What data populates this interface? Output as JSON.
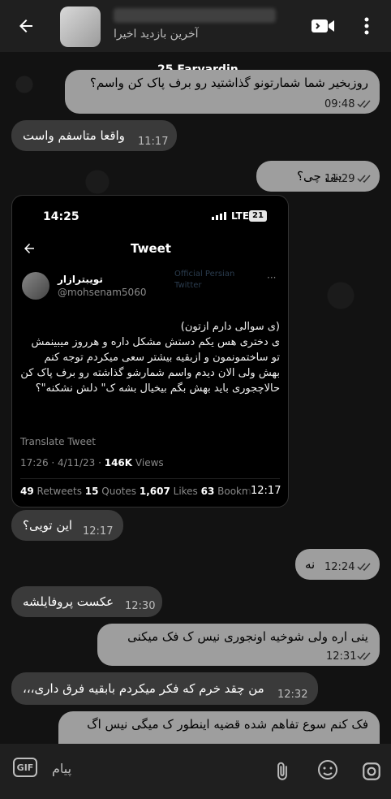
{
  "header": {
    "status": "آخرین بازدید اخیرا",
    "back_icon": "arrow-left-icon",
    "video_icon": "video-call-icon",
    "more_icon": "more-vertical-icon"
  },
  "date_separator": "25 Farvardin",
  "messages": [
    {
      "dir": "out",
      "text": "روزبخیر شما شمارتونو گذاشتید رو برف پاک کن واسم؟",
      "time": "09:48"
    },
    {
      "dir": "in",
      "text": "واقعا متاسفم واست",
      "time": "11:17"
    },
    {
      "dir": "out",
      "text": "ینی چی؟",
      "time": "11:29"
    },
    {
      "dir": "in",
      "text": "این تویی؟",
      "time": "12:17"
    },
    {
      "dir": "out",
      "text": "نه",
      "time": "12:24"
    },
    {
      "dir": "in",
      "text": "عکست پروفایلشه",
      "time": "12:30"
    },
    {
      "dir": "out",
      "text": "ینی اره ولی شوخیه اونجوری نیس ک فک میکنی",
      "time": "12:31"
    },
    {
      "dir": "in",
      "text": "من چقد خرم که فکر میکردم بابقیه فرق داری،،،",
      "time": "12:32"
    },
    {
      "dir": "out",
      "text": "فک کنم سوع تفاهم شده قضیه اینطور ک میگی نیس اگ"
    }
  ],
  "tweet": {
    "status_time": "14:25",
    "network": "LTE",
    "battery": "21",
    "title": "Tweet",
    "author_name": "تویبترازار",
    "author_handle": "@mohsenam5060",
    "watermark": "Official Persian Twitter",
    "body_line1": "(ی سوالی دارم ازتون)",
    "body_rest": "ی دختری هس یکم دستش مشکل داره و هرروز میبینمش تو ساختمونمون و ازبقیه بیشتر سعی میکردم توجه کنم بهش ولی الان دیدم واسم شمارشو گذاشته رو برف پاک کن حالاچجوری باید بهش بگم بیخیال بشه ک\" دلش نشکنه\"؟",
    "translate": "Translate Tweet",
    "datetime": "17:26 · 4/11/23 · ",
    "views_num": "146K",
    "views_label": " Views",
    "retweets_num": "49",
    "retweets_label": " Retweets ",
    "quotes_num": "15",
    "quotes_label": " Quotes ",
    "likes_num": "1,607",
    "likes_label": " Likes ",
    "bookmarks_num": "63",
    "bookmarks_label": " Bookm",
    "time": "12:17"
  },
  "input": {
    "placeholder": "پیام",
    "gif_label": "GIF"
  }
}
